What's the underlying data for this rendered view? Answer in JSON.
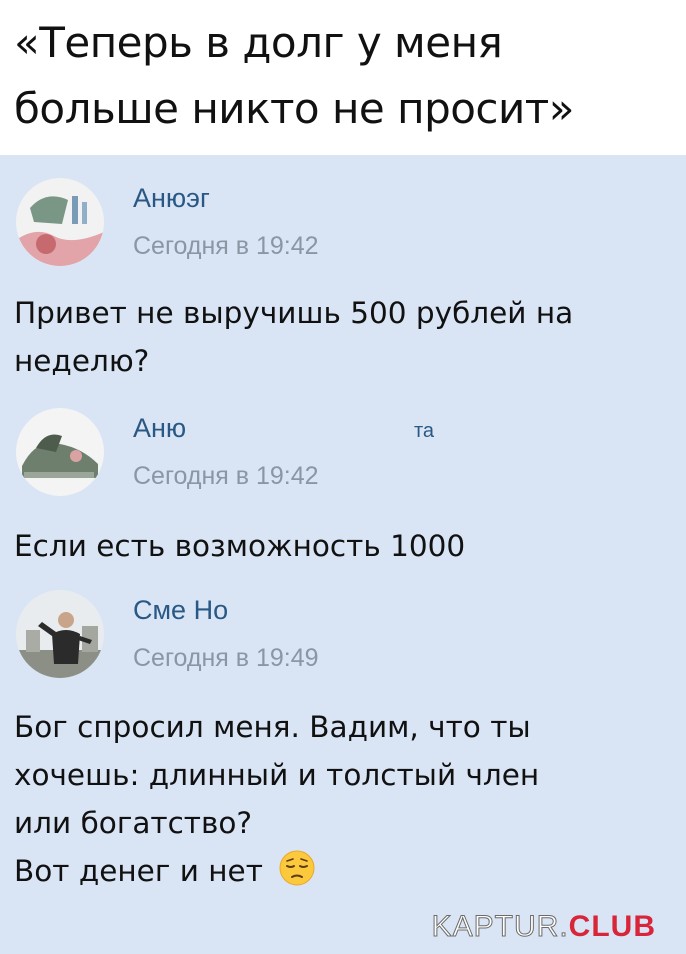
{
  "header": {
    "title": "«Теперь в долг у меня больше никто не просит»"
  },
  "messages": [
    {
      "author": "Анюэг",
      "time": "Сегодня в 19:42",
      "text_lines": [
        "Привет не выручишь 500 рублей на",
        "неделю?"
      ]
    },
    {
      "author": "Аню",
      "author_suffix": "та",
      "time": "Сегодня в 19:42",
      "text_lines": [
        "Если есть возможность 1000"
      ]
    },
    {
      "author": "Сме Но",
      "time": "Сегодня в 19:49",
      "text_lines": [
        "Бог спросил меня. Вадим, что ты",
        "хочешь: длинный и толстый член",
        "или богатство?",
        "Вот денег и нет"
      ],
      "emoji": "pensive-face-icon"
    }
  ],
  "watermark": {
    "main": "KAPTUR.",
    "accent": "CLUB"
  },
  "colors": {
    "chat_bg": "#d9e5f5",
    "author": "#2a5885",
    "time": "#8a96a3",
    "text": "#111111",
    "watermark_accent": "#d8253a"
  }
}
